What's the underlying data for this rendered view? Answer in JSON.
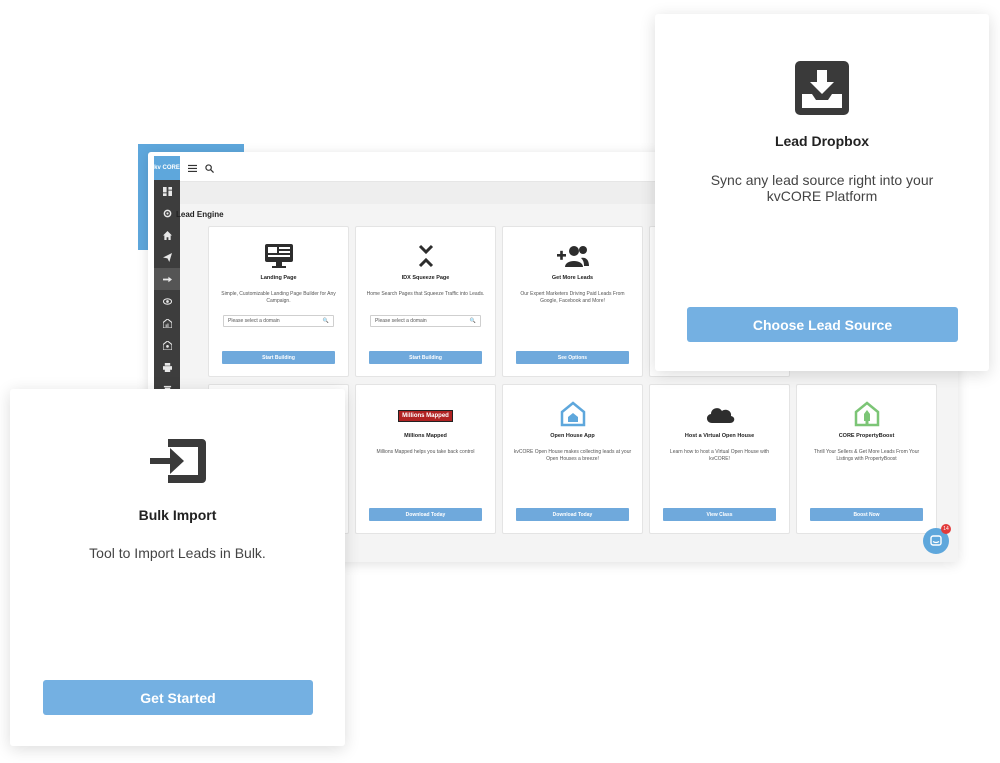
{
  "app": {
    "logo_text": "kv CORE",
    "section_title": "Lead Engine",
    "cards": [
      {
        "title": "Landing Page",
        "desc": "Simple, Customizable Landing Page Builder for Any Campaign.",
        "select": "Please select a domain",
        "button": "Start Building"
      },
      {
        "title": "IDX Squeeze Page",
        "desc": "Home Search Pages that Squeeze Traffic into Leads.",
        "select": "Please select a domain",
        "button": "Start Building"
      },
      {
        "title": "Get More Leads",
        "desc": "Our Expert Marketers Driving Paid Leads From Google, Facebook and More!",
        "button": "See Options"
      },
      {
        "title": "Millions Mapped",
        "logo": "Millions Mapped",
        "desc": "Millions Mapped helps you take back control",
        "button": "Download Today"
      },
      {
        "title": "Open House App",
        "desc": "kvCORE Open House makes collecting leads at your Open Houses a breeze!",
        "button": "Download Today"
      },
      {
        "title": "Host a Virtual Open House",
        "desc": "Learn how to host a Virtual Open House with kvCORE!",
        "button": "View Class"
      },
      {
        "title": "CORE PropertyBoost",
        "desc": "Thrill Your Sellers & Get More Leads From Your Listings with PropertyBoost",
        "button": "Boost Now"
      }
    ],
    "chat_badge": "14"
  },
  "lead_dropbox": {
    "title": "Lead Dropbox",
    "desc": "Sync any lead source right into your kvCORE Platform",
    "button": "Choose Lead Source",
    "icon": "inbox-download-icon"
  },
  "bulk_import": {
    "title": "Bulk Import",
    "desc": "Tool to Import Leads in Bulk.",
    "button": "Get Started",
    "icon": "import-icon"
  },
  "colors": {
    "accent": "#5ea7dc",
    "button": "#74b0e2",
    "sidebar": "#3d3d3d",
    "icon_dark": "#3a3a3a"
  }
}
